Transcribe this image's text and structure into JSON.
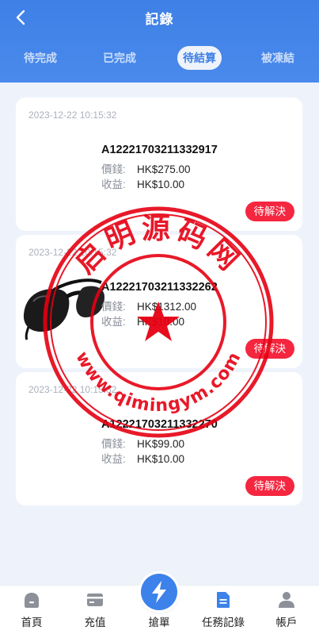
{
  "header": {
    "title": "記錄"
  },
  "tabs": [
    {
      "label": "待完成"
    },
    {
      "label": "已完成"
    },
    {
      "label": "待結算"
    },
    {
      "label": "被凍結"
    }
  ],
  "field_labels": {
    "price": "價錢:",
    "income": "收益:"
  },
  "records": [
    {
      "time": "2023-12-22 10:15:32",
      "order_no": "A12221703211332917",
      "price": "HK$275.00",
      "income": "HK$10.00",
      "status": "待解決"
    },
    {
      "time": "2023-12-22 10:15:32",
      "order_no": "A12221703211332262",
      "price": "HK$1312.00",
      "income": "HK$10.00",
      "status": "待解決"
    },
    {
      "time": "2023-12-22 10:15:32",
      "order_no": "A12221703211332270",
      "price": "HK$99.00",
      "income": "HK$10.00",
      "status": "待解決"
    }
  ],
  "watermark": {
    "top_text": "启明源码网",
    "bottom_text": "www.qimingym.com"
  },
  "nav": [
    {
      "label": "首頁"
    },
    {
      "label": "充值"
    },
    {
      "label": "搶單"
    },
    {
      "label": "任務記錄"
    },
    {
      "label": "帳戶"
    }
  ],
  "colors": {
    "primary": "#3d82ea",
    "status": "#f5263f",
    "stamp": "#e60012"
  }
}
